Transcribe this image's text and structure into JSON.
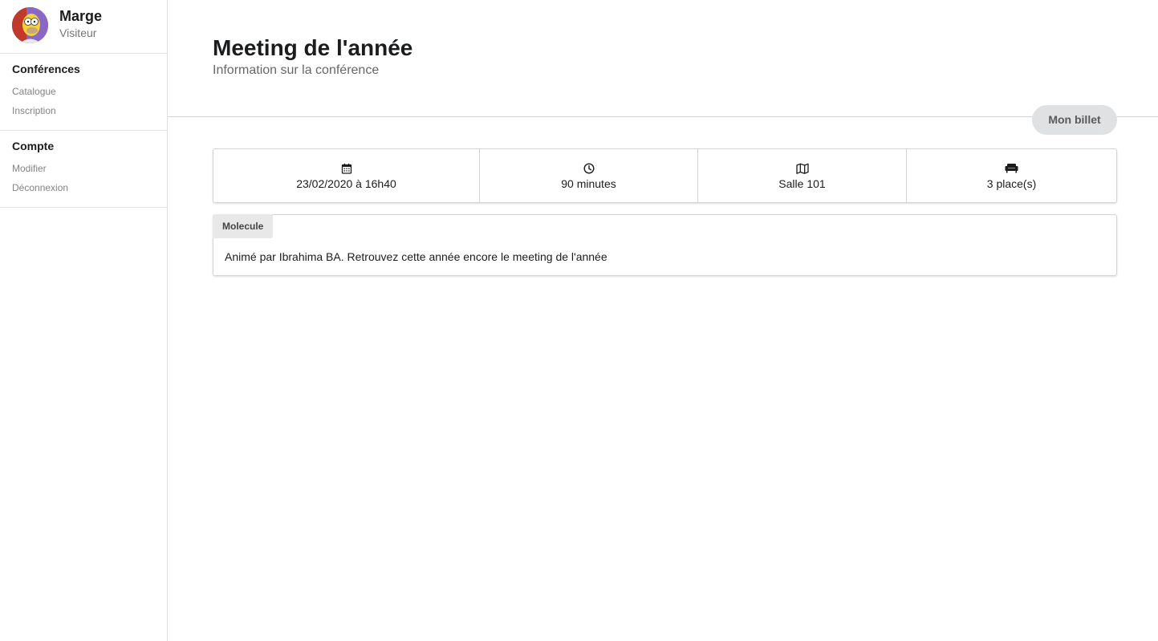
{
  "sidebar": {
    "user": {
      "name": "Marge",
      "role": "Visiteur"
    },
    "sections": [
      {
        "header": "Conférences",
        "items": [
          "Catalogue",
          "Inscription"
        ]
      },
      {
        "header": "Compte",
        "items": [
          "Modifier",
          "Déconnexion"
        ]
      }
    ]
  },
  "header": {
    "title": "Meeting de l'année",
    "subtitle": "Information sur la conférence"
  },
  "actions": {
    "ticket_label": "Mon billet"
  },
  "stats": {
    "date": {
      "icon": "calendar-icon",
      "value": "23/02/2020 à 16h40"
    },
    "duration": {
      "icon": "clock-icon",
      "value": "90 minutes"
    },
    "room": {
      "icon": "map-icon",
      "value": "Salle 101"
    },
    "seats": {
      "icon": "couch-icon",
      "value": "3 place(s)"
    }
  },
  "description": {
    "label": "Molecule",
    "text": "Animé par Ibrahima BA. Retrouvez cette année encore le meeting de l'année"
  },
  "colors": {
    "border": "#d4d4d5",
    "button_bg": "#e0e1e2",
    "label_bg": "#e8e8e8",
    "muted_text": "#838383"
  }
}
